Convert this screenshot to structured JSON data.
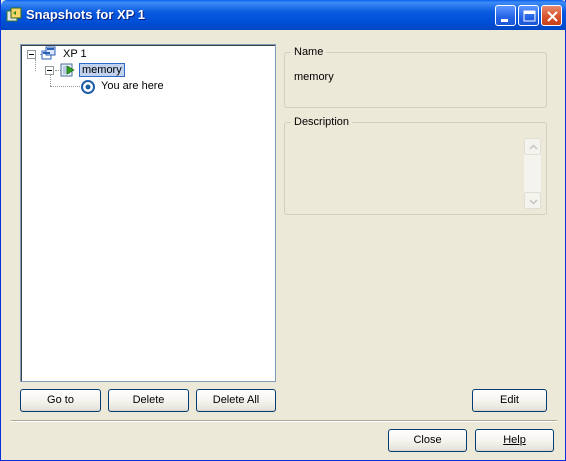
{
  "window": {
    "title": "Snapshots for XP 1",
    "title_icon": "snapshot-manager-icon",
    "controls": {
      "minimize": "minimize-icon",
      "maximize": "maximize-icon",
      "close": "close-icon"
    }
  },
  "tree": {
    "root": {
      "label": "XP 1",
      "icon": "virtual-machine-icon",
      "expanded": true
    },
    "snapshot": {
      "label": "memory",
      "icon": "snapshot-powered-on-icon",
      "expanded": true,
      "selected": true
    },
    "current": {
      "label": "You are here",
      "icon": "current-state-icon"
    }
  },
  "details": {
    "name_label": "Name",
    "name_value": "memory",
    "description_label": "Description",
    "description_value": ""
  },
  "buttons": {
    "goto": "Go to",
    "delete": "Delete",
    "delete_all": "Delete All",
    "edit": "Edit",
    "close": "Close",
    "help": "Help"
  },
  "colors": {
    "titlebar": "#0054e3",
    "dialog_bg": "#ece9d8",
    "selection_bg": "#c1d2ee",
    "button_border": "#003c74"
  }
}
